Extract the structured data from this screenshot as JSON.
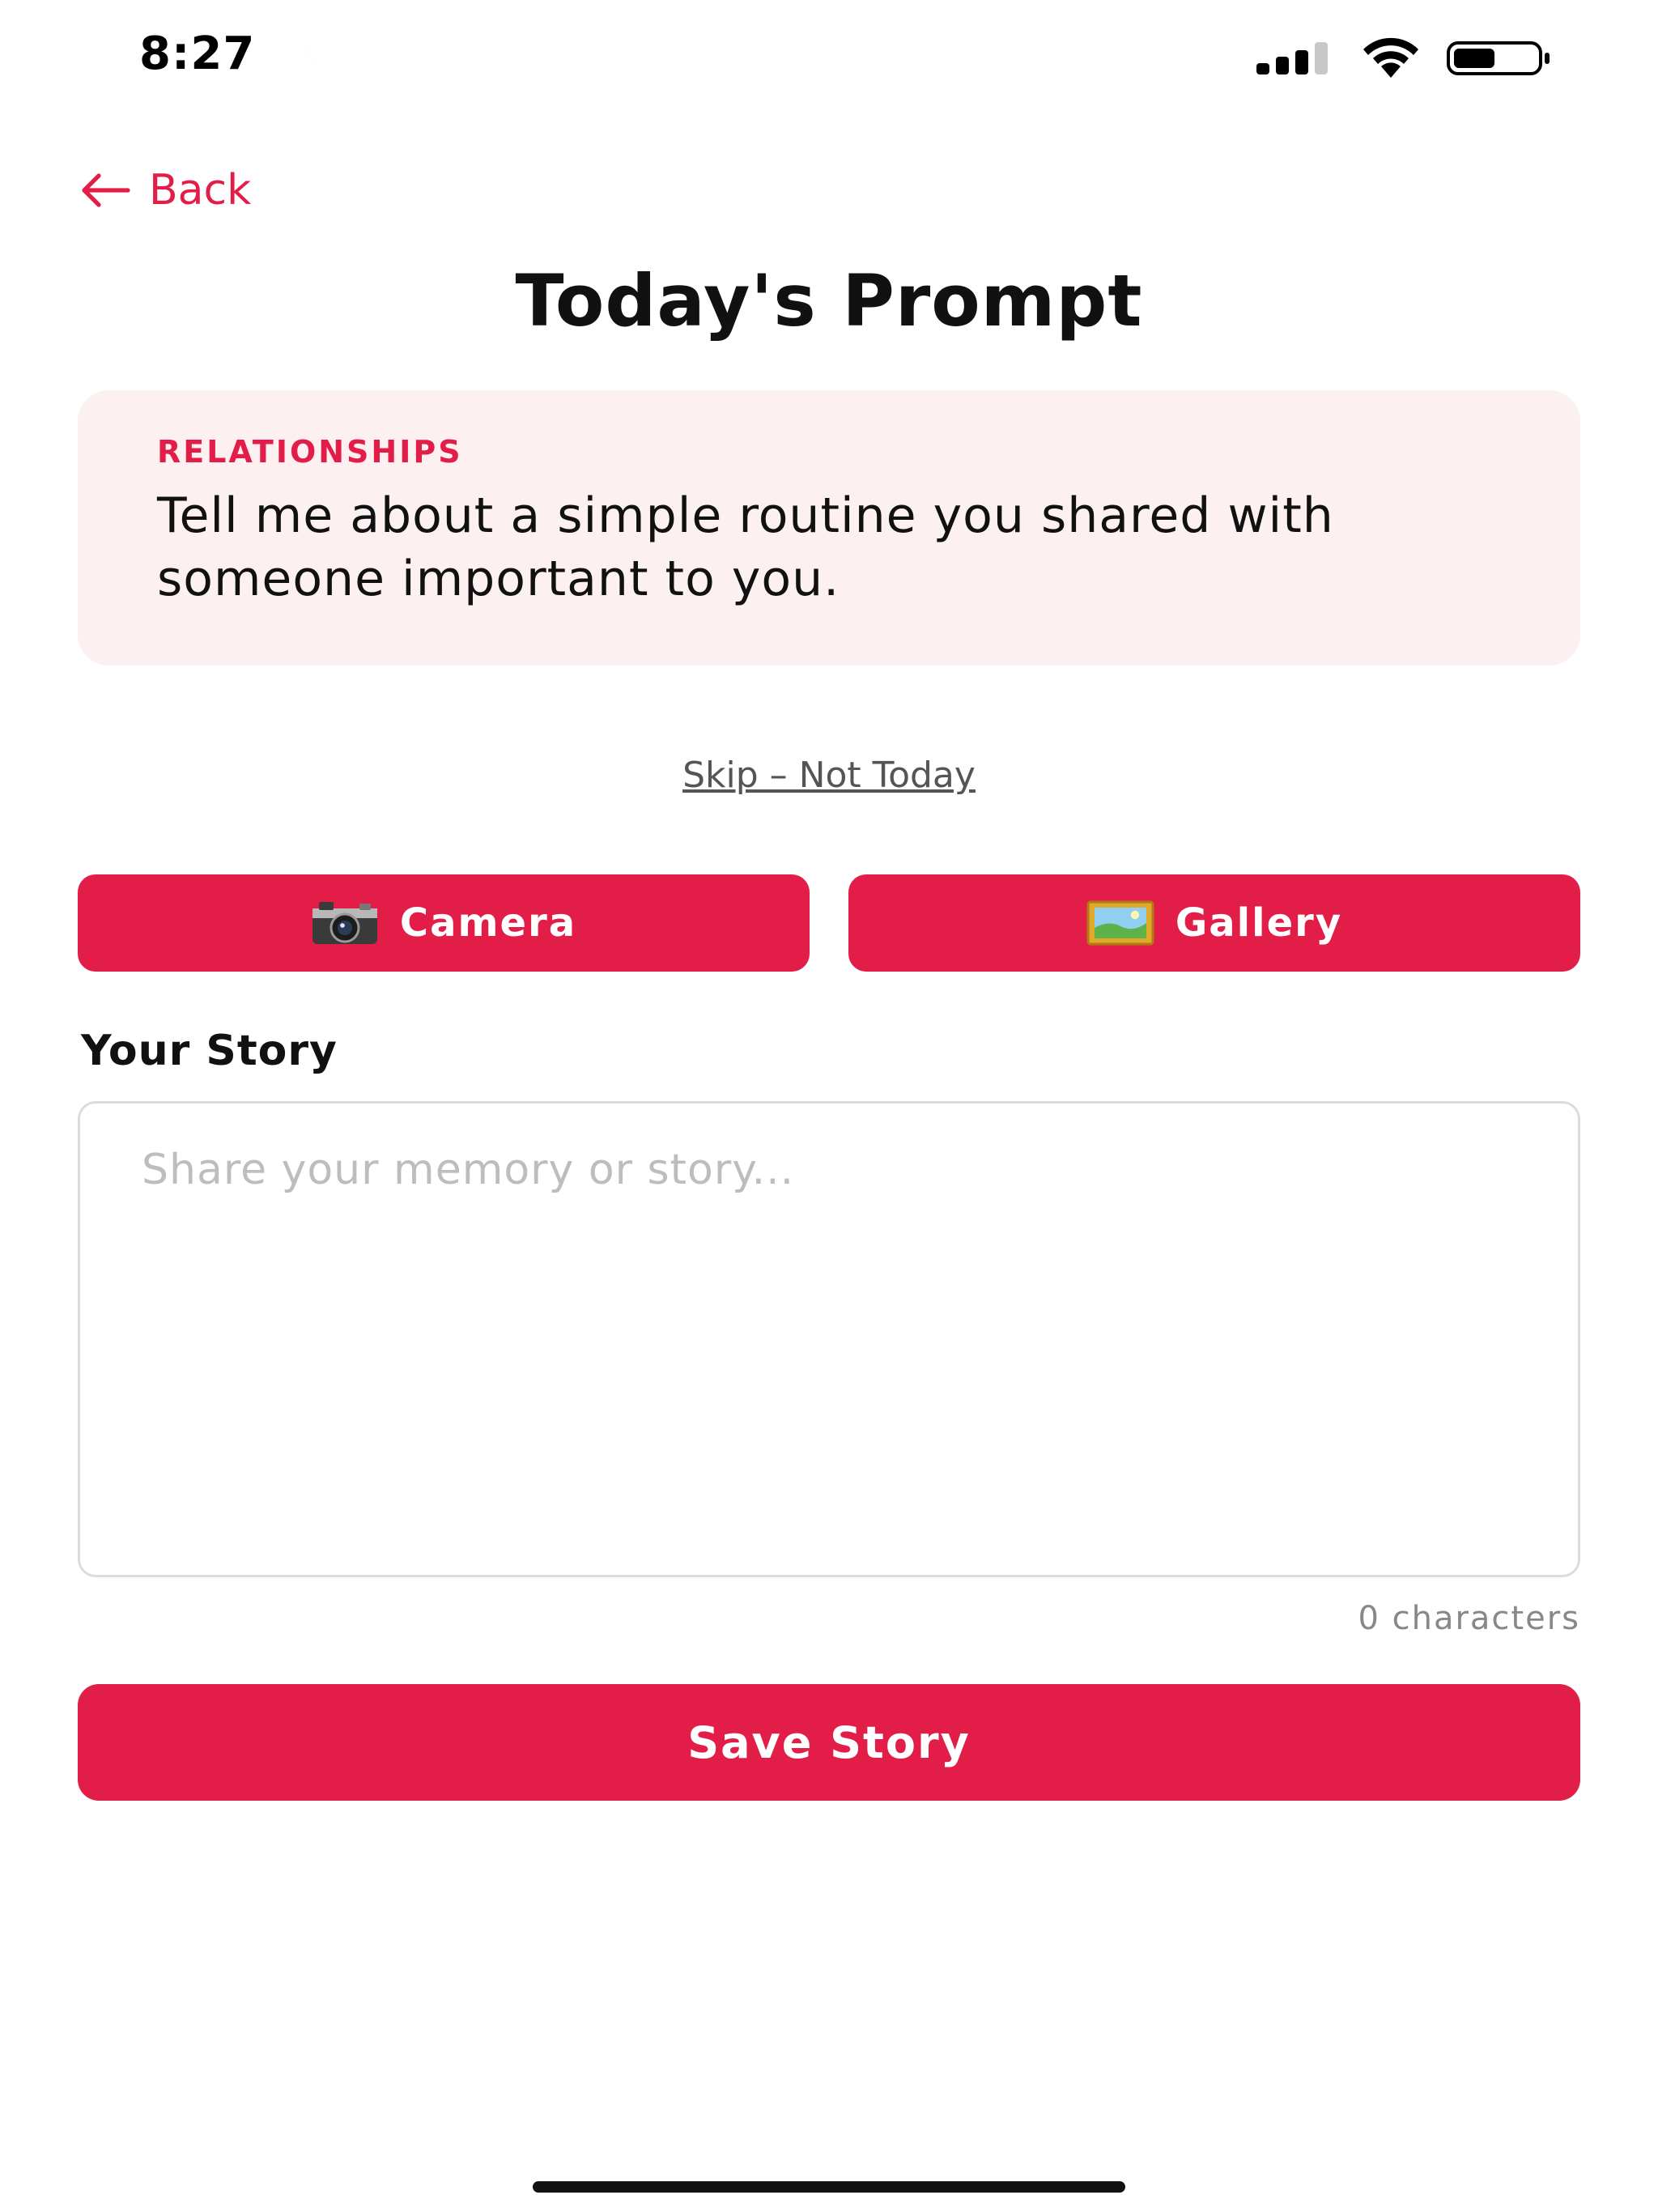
{
  "status_bar": {
    "time": "8:27",
    "icons": [
      "moon-icon",
      "signal-icon",
      "wifi-icon",
      "battery-icon"
    ]
  },
  "nav": {
    "back_label": "Back",
    "back_icon": "arrow-left-icon"
  },
  "header": {
    "title": "Today's Prompt"
  },
  "prompt": {
    "category": "RELATIONSHIPS",
    "text": "Tell me about a simple routine you shared with someone important to you."
  },
  "skip": {
    "label": "Skip – Not Today"
  },
  "media": {
    "camera_label": "Camera",
    "camera_icon": "camera-icon",
    "gallery_label": "Gallery",
    "gallery_icon": "picture-icon"
  },
  "story": {
    "label": "Your Story",
    "placeholder": "Share your memory or story...",
    "value": "",
    "char_count": "0 characters"
  },
  "save": {
    "label": "Save Story"
  },
  "colors": {
    "accent": "#e21d48",
    "card_background": "#fdf0f1",
    "text_primary": "#111111",
    "placeholder": "#bdbdbd"
  }
}
